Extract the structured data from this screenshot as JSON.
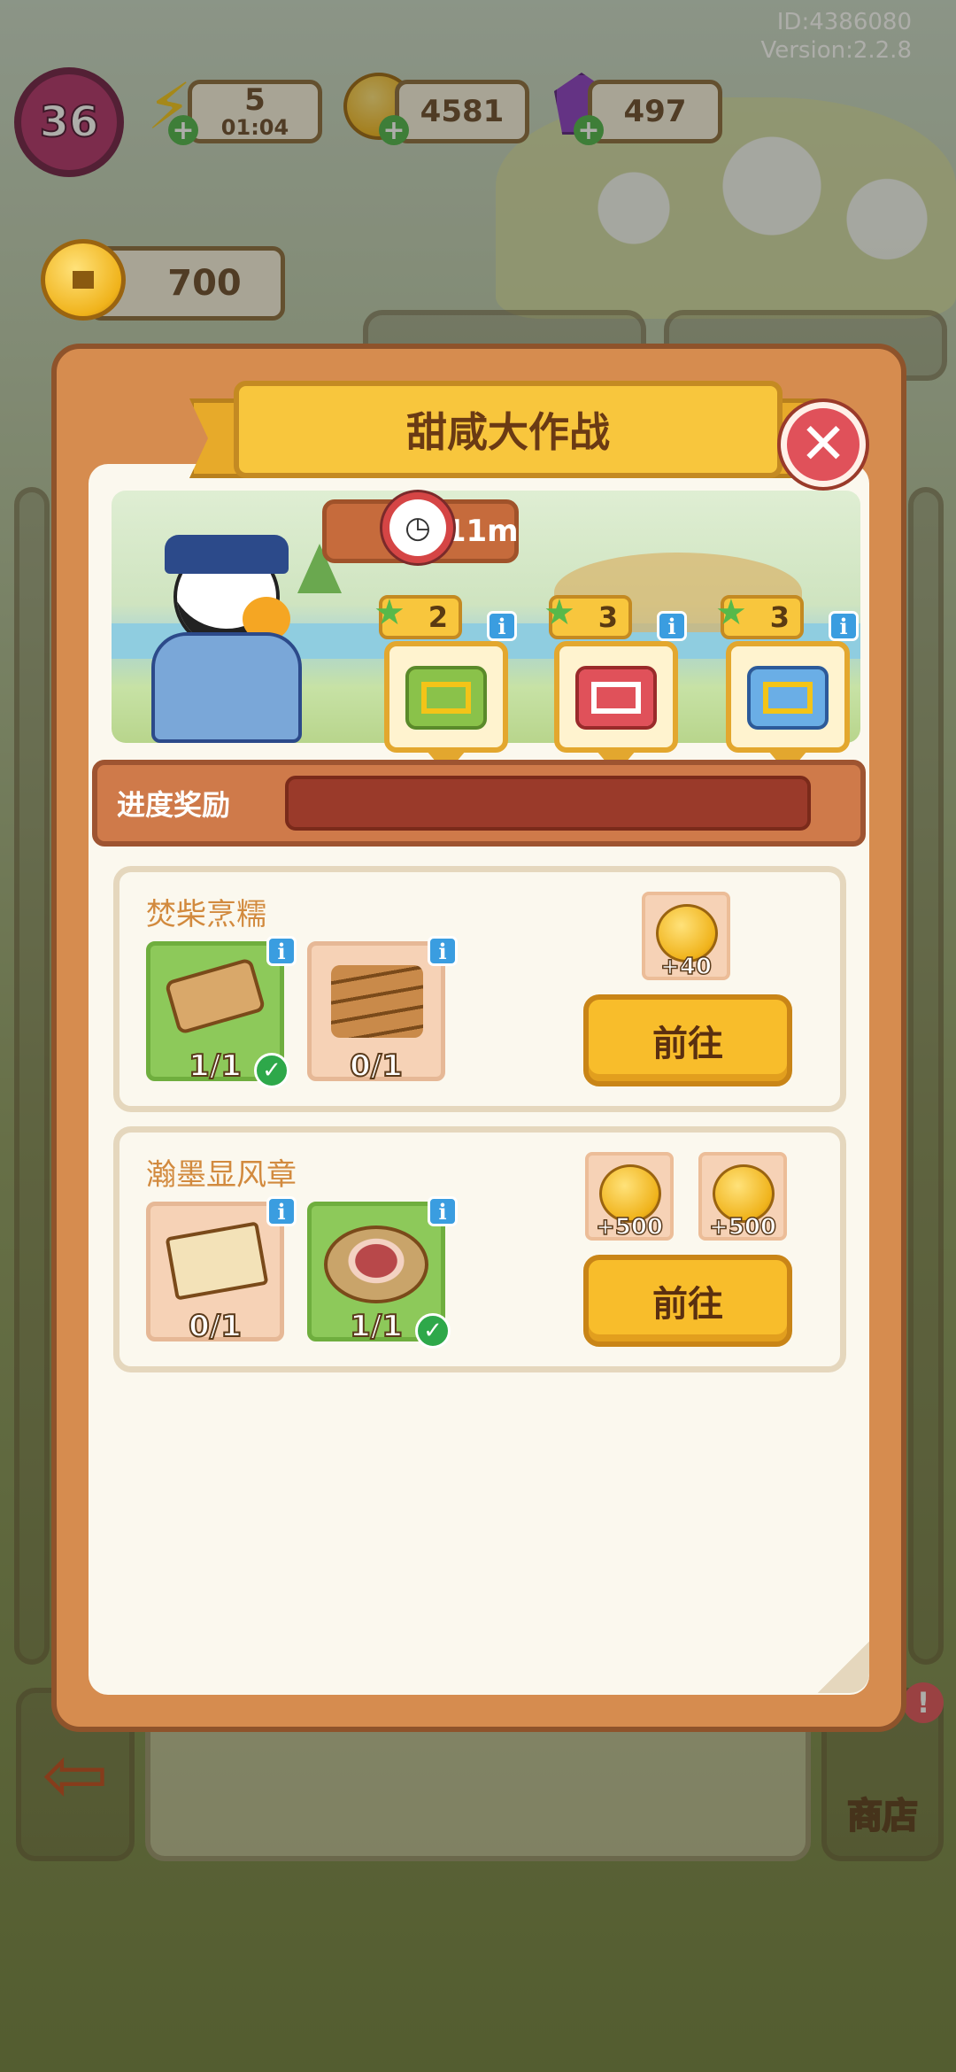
{
  "meta": {
    "id_text": "ID:4386080",
    "version_text": "Version:2.2.8"
  },
  "hud": {
    "level": "36",
    "energy": "5",
    "energy_timer": "01:04",
    "coins": "4581",
    "gems": "497",
    "side_coins": "700"
  },
  "colors": {
    "panel": "#d68c4f",
    "panel_border": "#8e532b",
    "title_bg": "#f8c63d",
    "go_button": "#f8bd2b",
    "done_green": "#8dc95a",
    "close_red": "#e0515a"
  },
  "event": {
    "title": "甜咸大作战",
    "timer": "5h11m",
    "progress_label": "进度奖励",
    "progress_fraction": 0,
    "rewards": [
      {
        "stars": "2",
        "icon": "green-gift-icon"
      },
      {
        "stars": "3",
        "icon": "red-gift-icon"
      },
      {
        "stars": "3",
        "icon": "blue-gift-icon"
      }
    ]
  },
  "tasks": [
    {
      "title": "焚柴烹糯",
      "items": [
        {
          "icon": "wood-log-icon",
          "count": "1/1",
          "done": true
        },
        {
          "icon": "firewood-pile-icon",
          "count": "0/1",
          "done": false
        }
      ],
      "rewards": [
        {
          "icon": "coin-icon",
          "amount": "+40"
        }
      ],
      "button": "前往"
    },
    {
      "title": "瀚墨显风章",
      "items": [
        {
          "icon": "scroll-icon",
          "count": "0/1",
          "done": false
        },
        {
          "icon": "ham-platter-icon",
          "count": "1/1",
          "done": true
        }
      ],
      "rewards": [
        {
          "icon": "coin-icon",
          "amount": "+500"
        },
        {
          "icon": "coin-icon",
          "amount": "+500"
        }
      ],
      "button": "前往"
    }
  ],
  "bottom": {
    "shop_label": "商店"
  }
}
